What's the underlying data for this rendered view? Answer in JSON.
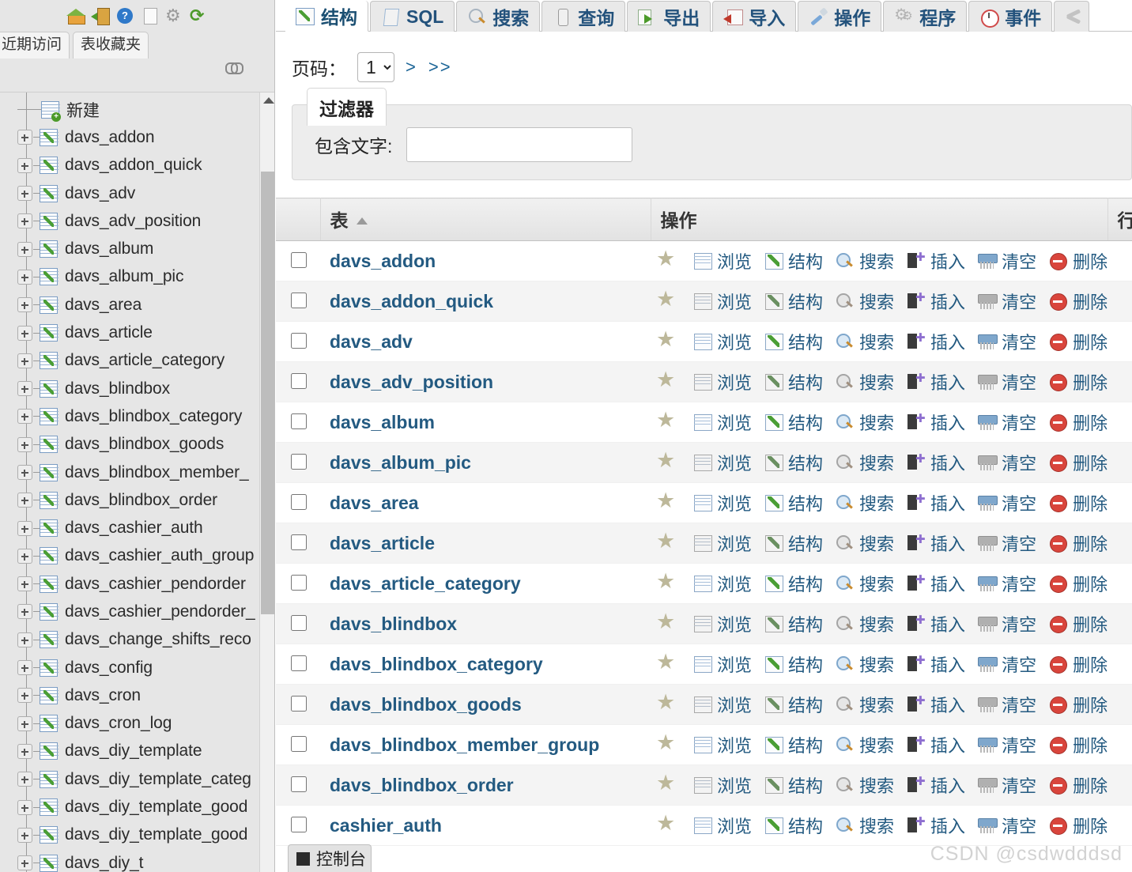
{
  "sidebar": {
    "toolbar_icons": [
      {
        "name": "home-icon",
        "label": "主页"
      },
      {
        "name": "exit-icon",
        "label": "退出"
      },
      {
        "name": "help-icon",
        "label": "帮助"
      },
      {
        "name": "document-icon",
        "label": "文档"
      },
      {
        "name": "settings-gear-icon",
        "label": "设置"
      },
      {
        "name": "refresh-icon",
        "label": "重新加载"
      }
    ],
    "tabs": [
      {
        "label": "近期访问",
        "active": false
      },
      {
        "label": "表收藏夹",
        "active": false
      }
    ],
    "chain_icon": "link-icon",
    "tree": [
      {
        "label": "新建",
        "type": "new"
      },
      {
        "label": "davs_addon",
        "type": "table"
      },
      {
        "label": "davs_addon_quick",
        "type": "table"
      },
      {
        "label": "davs_adv",
        "type": "table"
      },
      {
        "label": "davs_adv_position",
        "type": "table"
      },
      {
        "label": "davs_album",
        "type": "table"
      },
      {
        "label": "davs_album_pic",
        "type": "table"
      },
      {
        "label": "davs_area",
        "type": "table"
      },
      {
        "label": "davs_article",
        "type": "table"
      },
      {
        "label": "davs_article_category",
        "type": "table"
      },
      {
        "label": "davs_blindbox",
        "type": "table"
      },
      {
        "label": "davs_blindbox_category",
        "type": "table"
      },
      {
        "label": "davs_blindbox_goods",
        "type": "table"
      },
      {
        "label": "davs_blindbox_member_",
        "type": "table"
      },
      {
        "label": "davs_blindbox_order",
        "type": "table"
      },
      {
        "label": "davs_cashier_auth",
        "type": "table"
      },
      {
        "label": "davs_cashier_auth_group",
        "type": "table"
      },
      {
        "label": "davs_cashier_pendorder",
        "type": "table"
      },
      {
        "label": "davs_cashier_pendorder_",
        "type": "table"
      },
      {
        "label": "davs_change_shifts_reco",
        "type": "table"
      },
      {
        "label": "davs_config",
        "type": "table"
      },
      {
        "label": "davs_cron",
        "type": "table"
      },
      {
        "label": "davs_cron_log",
        "type": "table"
      },
      {
        "label": "davs_diy_template",
        "type": "table"
      },
      {
        "label": "davs_diy_template_categ",
        "type": "table"
      },
      {
        "label": "davs_diy_template_good",
        "type": "table"
      },
      {
        "label": "davs_diy_template_good",
        "type": "table"
      },
      {
        "label": "davs_diy_t",
        "type": "table"
      }
    ]
  },
  "main": {
    "tabs": [
      {
        "label": "结构",
        "icon": "structure-icon",
        "active": true
      },
      {
        "label": "SQL",
        "icon": "sql-icon",
        "active": false
      },
      {
        "label": "搜索",
        "icon": "search-icon",
        "active": false
      },
      {
        "label": "查询",
        "icon": "query-icon",
        "active": false
      },
      {
        "label": "导出",
        "icon": "export-icon",
        "active": false
      },
      {
        "label": "导入",
        "icon": "import-icon",
        "active": false
      },
      {
        "label": "操作",
        "icon": "operations-icon",
        "active": false
      },
      {
        "label": "程序",
        "icon": "routines-icon",
        "active": false
      },
      {
        "label": "事件",
        "icon": "events-icon",
        "active": false
      },
      {
        "label": "",
        "icon": "triggers-icon",
        "active": false
      }
    ],
    "pagination": {
      "label": "页码：",
      "current_page": "1",
      "options": [
        "1"
      ],
      "next_label": ">",
      "last_label": ">>"
    },
    "filter": {
      "legend": "过滤器",
      "label": "包含文字:",
      "value": "",
      "placeholder": ""
    },
    "table": {
      "headers": {
        "checkbox": "",
        "name": "表",
        "action": "操作",
        "rows": "行"
      },
      "sort": "asc",
      "action_labels": {
        "favorite": "",
        "browse": "浏览",
        "structure": "结构",
        "search": "搜索",
        "insert": "插入",
        "empty": "清空",
        "drop": "删除"
      },
      "rows": [
        {
          "name": "davs_addon"
        },
        {
          "name": "davs_addon_quick"
        },
        {
          "name": "davs_adv"
        },
        {
          "name": "davs_adv_position"
        },
        {
          "name": "davs_album"
        },
        {
          "name": "davs_album_pic"
        },
        {
          "name": "davs_area"
        },
        {
          "name": "davs_article"
        },
        {
          "name": "davs_article_category"
        },
        {
          "name": "davs_blindbox"
        },
        {
          "name": "davs_blindbox_category"
        },
        {
          "name": "davs_blindbox_goods"
        },
        {
          "name": "davs_blindbox_member_group"
        },
        {
          "name": "davs_blindbox_order"
        },
        {
          "name": "cashier_auth"
        }
      ]
    },
    "console": {
      "label": "控制台"
    }
  },
  "watermark": "CSDN @csdwdddsd"
}
